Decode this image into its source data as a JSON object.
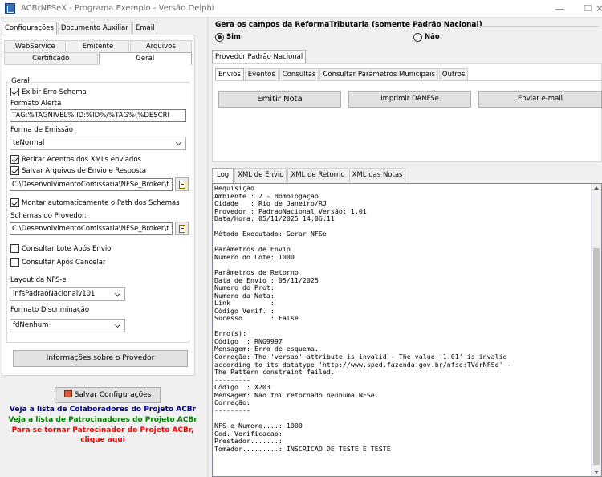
{
  "window": {
    "title": "ACBrNFSeX - Programa Exemplo - Versão Delphi",
    "minimize": "—",
    "maximize": "☐",
    "close": "✕"
  },
  "left_tabs": {
    "row1": [
      "Configurações",
      "Documento Auxiliar",
      "Email"
    ],
    "row2": [
      "WebService",
      "Emitente",
      "Arquivos"
    ],
    "row3": [
      "Certificado",
      "Geral"
    ]
  },
  "geral": {
    "group_label": "Geral",
    "exibir_erro_schema": "Exibir Erro Schema",
    "formato_alerta_label": "Formato Alerta",
    "formato_alerta_value": "TAG:%TAGNIVEL% ID:%ID%/%TAG%(%DESCRI",
    "forma_emissao_label": "Forma de Emissão",
    "forma_emissao_value": "teNormal",
    "retirar_acentos": "Retirar Acentos dos XMLs enviados",
    "salvar_arquivos": "Salvar Arquivos de Envio e Resposta",
    "path_arquivos": "C:\\DesenvolvimentoComissaria\\NFSe_Broker\\t",
    "montar_path": "Montar automaticamente o Path dos Schemas",
    "schemas_label": "Schemas do Provedor:",
    "schemas_value": "C:\\DesenvolvimentoComissaria\\NFSe_Broker\\t",
    "consultar_lote": "Consultar Lote Após Envio",
    "consultar_cancelar": "Consultar Após Cancelar",
    "layout_label": "Layout da NFS-e",
    "layout_value": "lnfsPadraoNacionalv101",
    "formato_disc_label": "Formato Discriminação",
    "formato_disc_value": "fdNenhum",
    "info_provedor_btn": "Informações sobre o Provedor"
  },
  "checks": {
    "exibir_erro_schema": true,
    "retirar_acentos": true,
    "salvar_arquivos": true,
    "montar_path": true,
    "consultar_lote": false,
    "consultar_cancelar": false
  },
  "salvar_btn": "Salvar Configurações",
  "links": {
    "colaboradores": "Veja a lista de Colaboradores do Projeto ACBr",
    "patrocinadores": "Veja a lista de Patrocinadores do Projeto ACBr",
    "tornar_line1": "Para se tornar Patrocinador do Projeto ACBr,",
    "tornar_line2": "clique aqui"
  },
  "link_colors": {
    "colaboradores": "#00008b",
    "patrocinadores": "#008000",
    "tornar": "#ff0000"
  },
  "reforma": {
    "title": "Gera os campos da ReformaTributaria (somente Padrão Nacional)",
    "sim": "Sim",
    "nao": "Não",
    "selected": "Sim"
  },
  "provider_tab": "Provedor Padrão Nacional",
  "action_tabs": [
    "Envios",
    "Eventos",
    "Consultas",
    "Consultar Parâmetros Municipais",
    "Outros"
  ],
  "actions": {
    "emitir": "Emitir Nota",
    "imprimir": "Imprimir DANFSe",
    "enviar": "Enviar e-mail"
  },
  "log_tabs": [
    "Log",
    "XML de Envio",
    "XML de Retorno",
    "XML das Notas"
  ],
  "log_lines": [
    "Requisição",
    "Ambiente : 2 - Homologação",
    "Cidade   : Rio de Janeiro/RJ",
    "Provedor : PadraoNacional Versão: 1.01",
    "Data/Hora: 05/11/2025 14:06:11",
    "",
    "Método Executado: Gerar NFSe",
    "",
    "Parâmetros de Envio",
    "Numero do Lote: 1000",
    "",
    "Parâmetros de Retorno",
    "Data de Envio : 05/11/2025",
    "Numero do Prot:",
    "Numero da Nota:",
    "Link          :",
    "Código Verif. :",
    "Sucesso       : False",
    "",
    "Erro(s):",
    "Código  : RNG9997",
    "Mensagem: Erro de esquema.",
    "Correção: The 'versao' attribute is invalid - The value '1.01' is invalid",
    "according to its datatype 'http://www.sped.fazenda.gov.br/nfse:TVerNFSe' -",
    "The Pattern constraint failed.",
    "---------",
    "Código  : X203",
    "Mensagem: Não foi retornado nenhuma NFSe.",
    "Correção:",
    "---------",
    "",
    "NFS-e Numero....: 1000",
    "Cod. Verificacao:",
    "Prestador.......:",
    "Tomador.........: INSCRICAO DE TESTE E TESTE"
  ]
}
